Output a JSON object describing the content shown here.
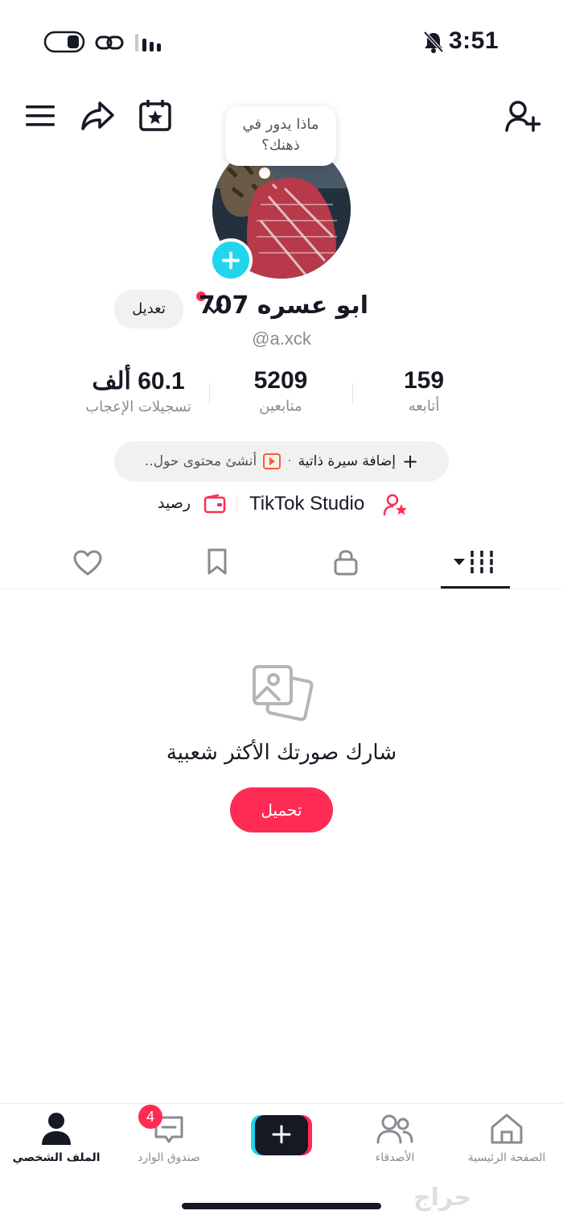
{
  "status_bar": {
    "time": "3:51",
    "icons": [
      "toggle-icon",
      "link-icon",
      "signal-icon",
      "bell-off-icon"
    ]
  },
  "header": {
    "icons": [
      "menu-icon",
      "share-icon",
      "calendar-star-icon",
      "add-friend-icon"
    ]
  },
  "profile": {
    "note_bubble_line1": "ماذا يدور في",
    "note_bubble_line2": "ذهنك؟",
    "username": "ابو عسره 707",
    "handle": "@a.xck",
    "edit_label": "تعديل"
  },
  "stats": [
    {
      "value": "159",
      "label": "أتابعه"
    },
    {
      "value": "5209",
      "label": "متابعين"
    },
    {
      "value": "60.1 ألف",
      "label": "تسجيلات الإعجاب"
    }
  ],
  "bio_bar": {
    "add_bio": "إضافة سيرة ذاتية",
    "separator": "·",
    "create_content": "أنشئ محتوى حول.."
  },
  "links": {
    "studio": "TikTok Studio",
    "balance": "رصيد"
  },
  "content_tabs": [
    "videos-grid-icon",
    "lock-icon",
    "bookmark-icon",
    "heart-icon"
  ],
  "empty_state": {
    "title": "شارك صورتك الأكثر شعبية",
    "upload_label": "تحميل"
  },
  "bottom_nav": {
    "home": "الصفحة الرئيسية",
    "friends": "الأصدقاء",
    "inbox": "صندوق الوارد",
    "inbox_badge": "4",
    "profile": "الملف الشخصي"
  },
  "watermark": "حراج",
  "colors": {
    "accent": "#fe2c55",
    "cyan": "#20d5ec",
    "text": "#161823",
    "muted": "#8a8b91"
  }
}
